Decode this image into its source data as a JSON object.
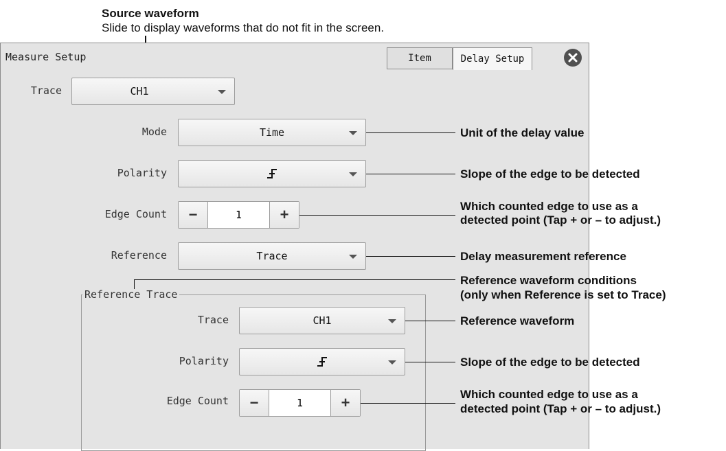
{
  "annotations": {
    "source_title": "Source waveform",
    "source_desc": "Slide to display waveforms that do not fit in the screen.",
    "unit_delay": "Unit of the delay value",
    "slope1": "Slope of the edge to be detected",
    "edge_count1_line1": "Which counted edge to use as a",
    "edge_count1_line2": "detected point (Tap + or – to adjust.)",
    "delay_ref": "Delay measurement reference",
    "ref_cond_line1": "Reference waveform conditions",
    "ref_cond_line2": "(only when Reference is set to Trace)",
    "ref_wave": "Reference waveform",
    "slope2": "Slope of the edge to be detected",
    "edge_count2_line1": "Which counted edge to use as a",
    "edge_count2_line2": "detected point (Tap + or – to adjust.)"
  },
  "dialog": {
    "title": "Measure Setup",
    "tabs": [
      {
        "label": "Item"
      },
      {
        "label": "Delay Setup"
      }
    ],
    "active_tab": "Delay Setup"
  },
  "form": {
    "trace_label": "Trace",
    "trace_value": "CH1",
    "mode_label": "Mode",
    "mode_value": "Time",
    "polarity_label": "Polarity",
    "polarity_value": "rising-edge",
    "edge_count_label": "Edge Count",
    "edge_count_value": "1",
    "reference_label": "Reference",
    "reference_value": "Trace",
    "minus": "−",
    "plus": "+"
  },
  "reference_trace": {
    "group_title": "Reference Trace",
    "trace_label": "Trace",
    "trace_value": "CH1",
    "polarity_label": "Polarity",
    "polarity_value": "rising-edge",
    "edge_count_label": "Edge Count",
    "edge_count_value": "1"
  }
}
